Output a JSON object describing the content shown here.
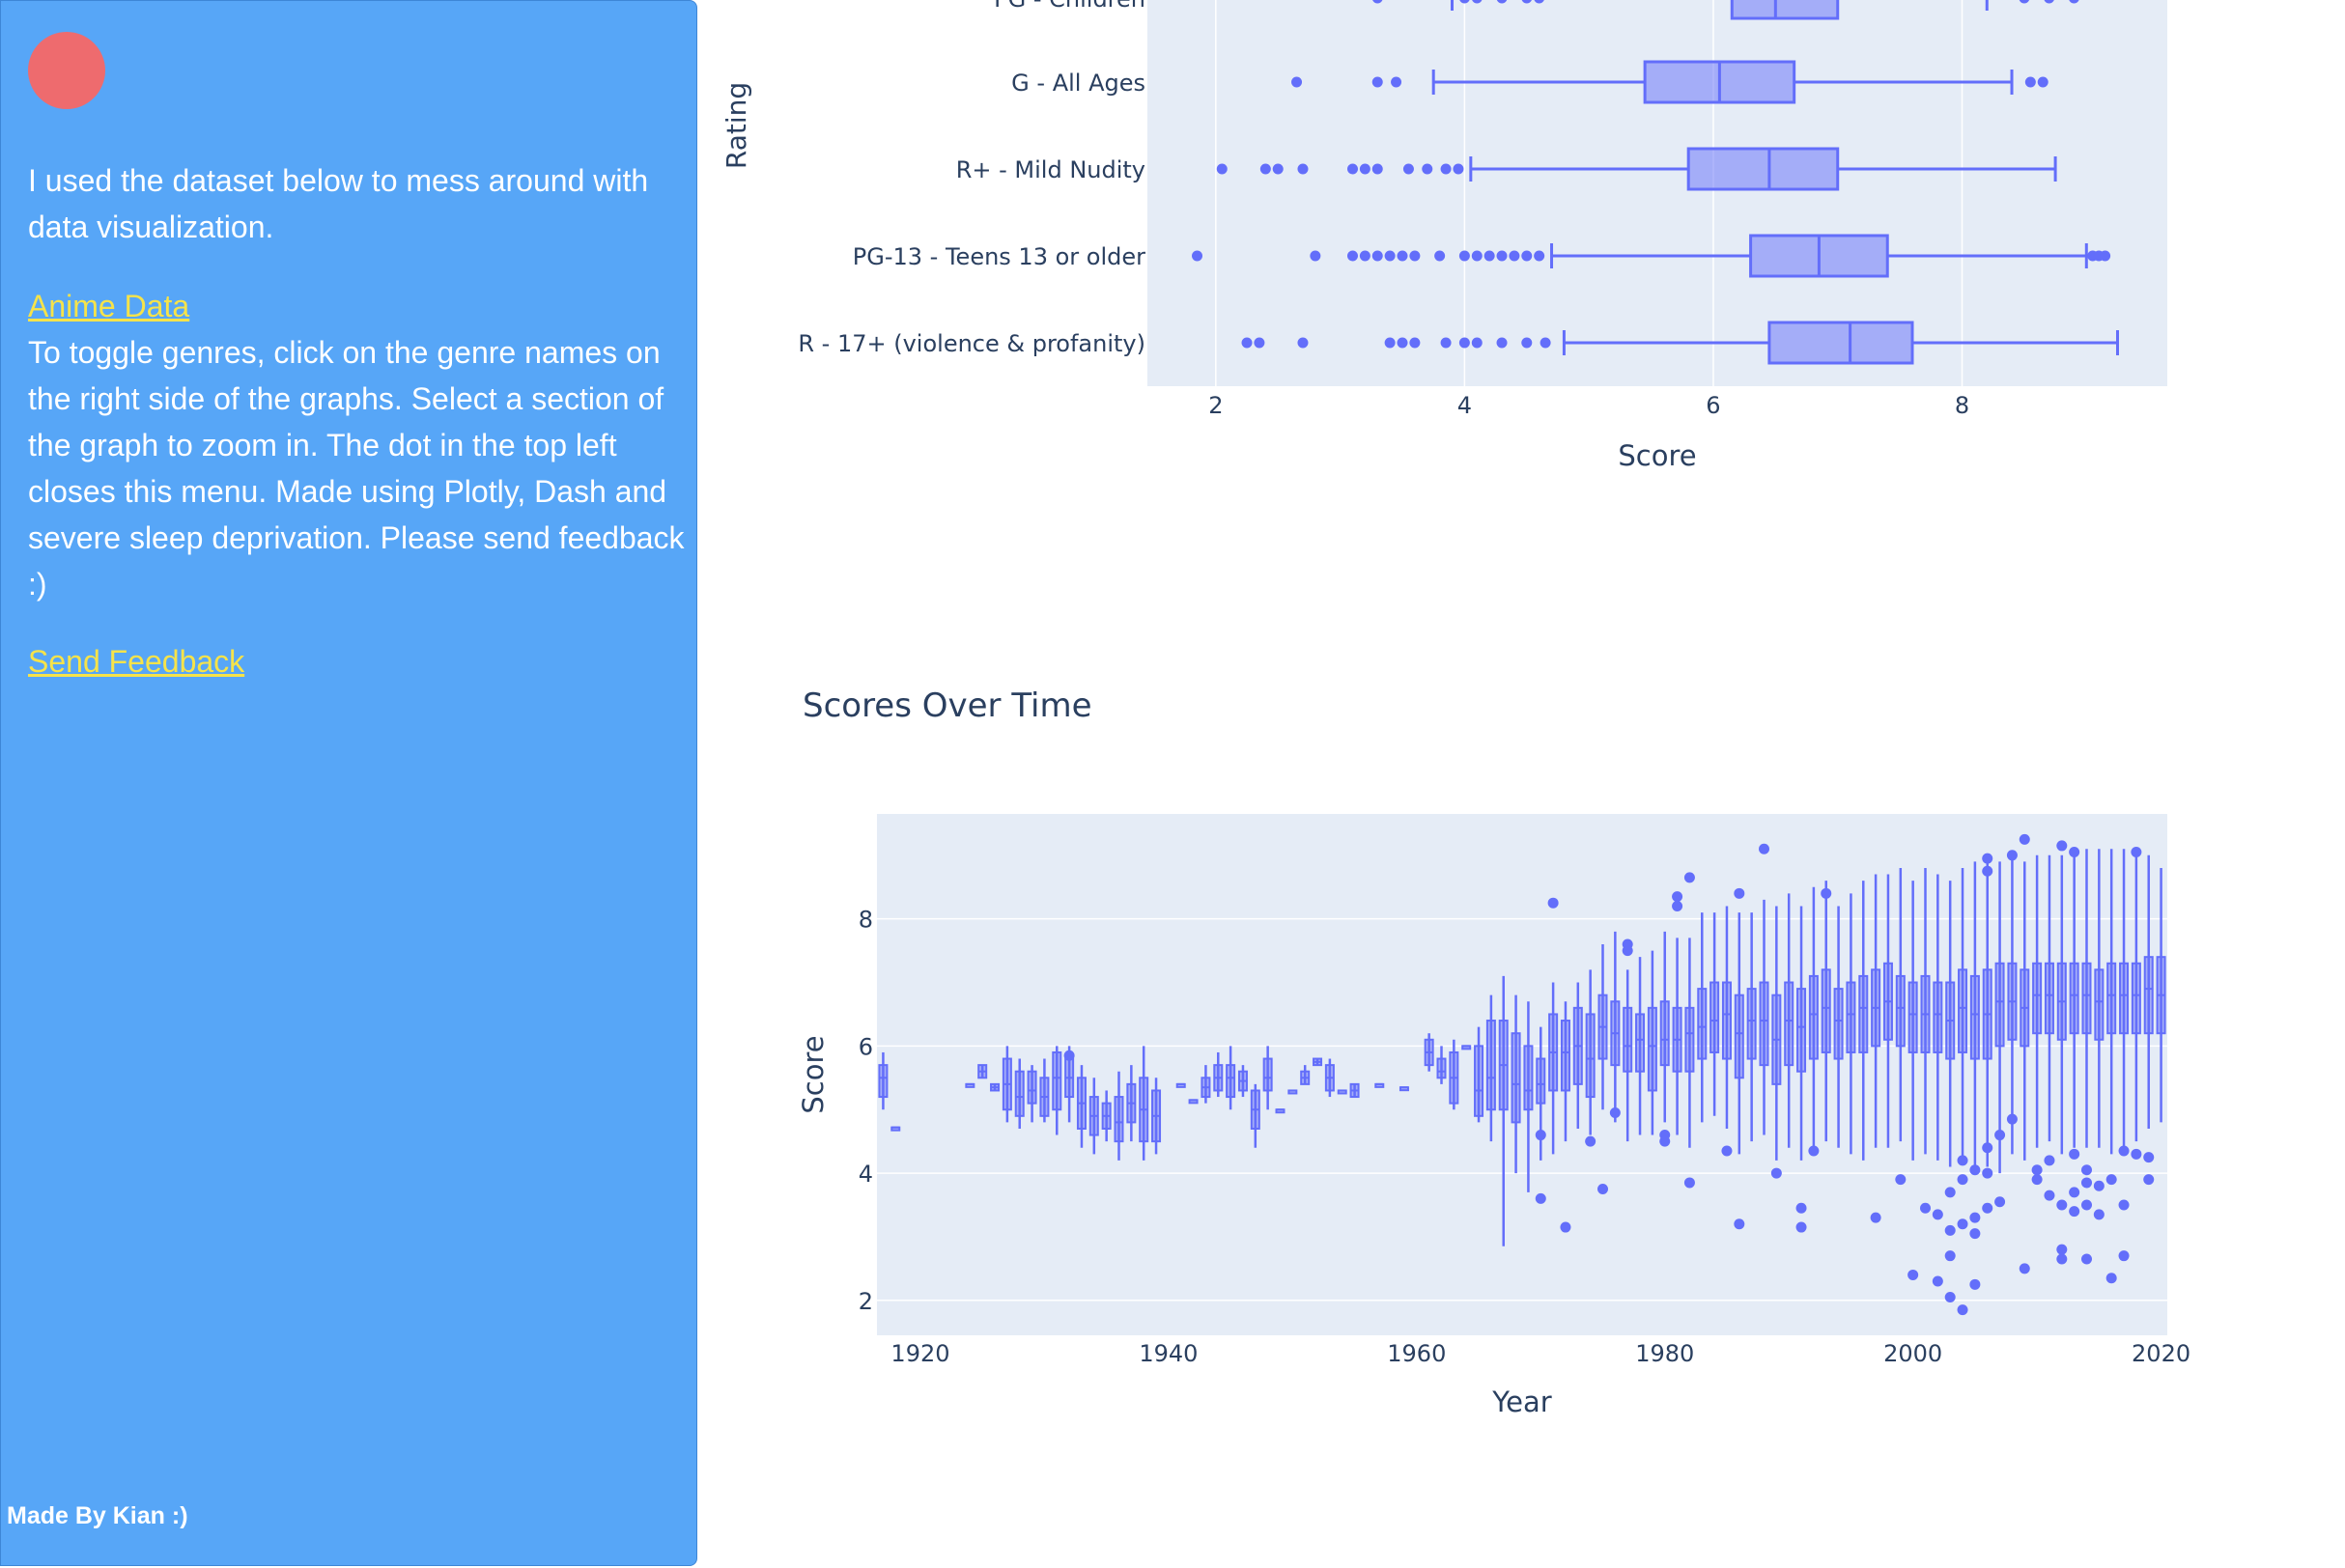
{
  "sidebar": {
    "intro": "I used the dataset below to mess around with data visualization.",
    "data_link": "Anime Data",
    "instructions": "To toggle genres, click on the genre names on the right side of the graphs. Select a section of the graph to zoom in. The dot in the top left closes this menu. Made using Plotly, Dash and severe sleep deprivation. Please send feedback :)",
    "feedback_link": "Send Feedback",
    "footer": "Made By Kian :)",
    "colors": {
      "background": "#57a6f7",
      "close_dot": "#ee6b6e",
      "link": "#f6e34a"
    }
  },
  "chart_data": [
    {
      "type": "box",
      "orientation": "horizontal",
      "ylabel": "Rating",
      "xlabel": "Score",
      "x_ticks": [
        2,
        4,
        6,
        8
      ],
      "xlim": [
        1.45,
        9.65
      ],
      "color": "#636efa",
      "categories": [
        {
          "name": "PG - Children",
          "min": 3.9,
          "q1": 6.15,
          "median": 6.5,
          "q3": 7.0,
          "max": 8.2,
          "outliers": [
            3.3,
            4.0,
            4.1,
            4.3,
            4.5,
            4.6,
            8.5,
            8.7,
            8.9
          ],
          "partial": true
        },
        {
          "name": "G - All Ages",
          "min": 3.75,
          "q1": 5.45,
          "median": 6.05,
          "q3": 6.65,
          "max": 8.4,
          "outliers": [
            2.65,
            3.3,
            3.45,
            8.55,
            8.65
          ]
        },
        {
          "name": "R+ - Mild Nudity",
          "min": 4.05,
          "q1": 5.8,
          "median": 6.45,
          "q3": 7.0,
          "max": 8.75,
          "outliers": [
            2.05,
            2.4,
            2.5,
            2.7,
            3.1,
            3.2,
            3.3,
            3.55,
            3.7,
            3.85,
            3.95
          ]
        },
        {
          "name": "PG-13 - Teens 13 or older",
          "min": 4.7,
          "q1": 6.3,
          "median": 6.85,
          "q3": 7.4,
          "max": 9.0,
          "outliers": [
            1.85,
            2.8,
            3.1,
            3.2,
            3.3,
            3.4,
            3.5,
            3.6,
            3.8,
            4.0,
            4.1,
            4.2,
            4.3,
            4.4,
            4.5,
            4.6,
            9.05,
            9.1,
            9.15
          ]
        },
        {
          "name": "R - 17+ (violence & profanity)",
          "min": 4.8,
          "q1": 6.45,
          "median": 7.1,
          "q3": 7.6,
          "max": 9.25,
          "outliers": [
            2.25,
            2.35,
            2.7,
            3.4,
            3.5,
            3.6,
            3.85,
            4.0,
            4.1,
            4.3,
            4.5,
            4.65
          ]
        }
      ]
    },
    {
      "type": "box",
      "orientation": "vertical",
      "title": "Scores Over Time",
      "xlabel": "Year",
      "ylabel": "Score",
      "x_ticks": [
        1920,
        1940,
        1960,
        1980,
        2000,
        2020
      ],
      "y_ticks": [
        2,
        4,
        6,
        8
      ],
      "xlim": [
        1916.5,
        2020.5
      ],
      "ylim": [
        1.45,
        9.65
      ],
      "color": "#636efa",
      "boxes": [
        [
          1917,
          5.2,
          5.7,
          5.0,
          5.9,
          5.5
        ],
        [
          1918,
          4.72,
          4.72,
          4.72,
          4.72,
          4.72
        ],
        [
          1924,
          5.4,
          5.4,
          5.4,
          5.4,
          5.4
        ],
        [
          1925,
          5.5,
          5.7,
          5.5,
          5.7,
          5.6
        ],
        [
          1926,
          5.3,
          5.4,
          5.3,
          5.4,
          5.35
        ],
        [
          1927,
          5.0,
          5.8,
          4.8,
          6.0,
          5.4
        ],
        [
          1928,
          4.9,
          5.6,
          4.7,
          5.8,
          5.2
        ],
        [
          1929,
          5.1,
          5.6,
          4.8,
          5.7,
          5.3
        ],
        [
          1930,
          4.9,
          5.5,
          4.8,
          5.8,
          5.2
        ],
        [
          1931,
          5.0,
          5.9,
          4.6,
          6.0,
          5.5
        ],
        [
          1932,
          5.2,
          5.8,
          4.8,
          6.0,
          5.5
        ],
        [
          1933,
          4.7,
          5.5,
          4.4,
          5.7,
          5.1
        ],
        [
          1934,
          4.6,
          5.2,
          4.3,
          5.5,
          4.9
        ],
        [
          1935,
          4.7,
          5.1,
          4.5,
          5.3,
          4.9
        ],
        [
          1936,
          4.5,
          5.2,
          4.2,
          5.6,
          4.8
        ],
        [
          1937,
          4.8,
          5.4,
          4.5,
          5.7,
          5.1
        ],
        [
          1938,
          4.5,
          5.5,
          4.2,
          6.0,
          5.0
        ],
        [
          1939,
          4.5,
          5.3,
          4.3,
          5.5,
          4.9
        ],
        [
          1941,
          5.4,
          5.4,
          5.4,
          5.4,
          5.4
        ],
        [
          1942,
          5.15,
          5.15,
          5.15,
          5.15,
          5.15
        ],
        [
          1943,
          5.2,
          5.5,
          5.1,
          5.7,
          5.35
        ],
        [
          1944,
          5.3,
          5.7,
          5.2,
          5.9,
          5.5
        ],
        [
          1945,
          5.2,
          5.7,
          5.0,
          6.0,
          5.5
        ],
        [
          1946,
          5.3,
          5.6,
          5.2,
          5.7,
          5.45
        ],
        [
          1947,
          4.7,
          5.3,
          4.4,
          5.4,
          5.0
        ],
        [
          1948,
          5.3,
          5.8,
          5.0,
          6.0,
          5.5
        ],
        [
          1949,
          5.0,
          5.0,
          5.0,
          5.0,
          5.0
        ],
        [
          1950,
          5.3,
          5.3,
          5.3,
          5.3,
          5.3
        ],
        [
          1951,
          5.4,
          5.6,
          5.4,
          5.7,
          5.5
        ],
        [
          1952,
          5.7,
          5.8,
          5.7,
          5.8,
          5.75
        ],
        [
          1953,
          5.3,
          5.7,
          5.2,
          5.8,
          5.5
        ],
        [
          1954,
          5.3,
          5.3,
          5.3,
          5.3,
          5.3
        ],
        [
          1955,
          5.2,
          5.4,
          5.2,
          5.4,
          5.3
        ],
        [
          1957,
          5.4,
          5.4,
          5.4,
          5.4,
          5.4
        ],
        [
          1959,
          5.35,
          5.35,
          5.35,
          5.35,
          5.35
        ],
        [
          1961,
          5.7,
          6.1,
          5.6,
          6.2,
          5.9
        ],
        [
          1962,
          5.5,
          5.8,
          5.4,
          6.0,
          5.6
        ],
        [
          1963,
          5.1,
          5.9,
          5.0,
          6.1,
          5.5
        ],
        [
          1964,
          6.0,
          6.0,
          6.0,
          6.0,
          6.0
        ],
        [
          1965,
          4.9,
          6.0,
          4.8,
          6.3,
          5.3
        ],
        [
          1966,
          5.0,
          6.4,
          4.5,
          6.8,
          5.5
        ],
        [
          1967,
          5.0,
          6.4,
          2.85,
          7.1,
          5.7
        ],
        [
          1968,
          4.8,
          6.2,
          4.0,
          6.8,
          5.4
        ],
        [
          1969,
          5.0,
          6.0,
          3.7,
          6.7,
          5.3
        ],
        [
          1970,
          5.1,
          5.8,
          4.2,
          6.3,
          5.4
        ],
        [
          1971,
          5.3,
          6.5,
          4.3,
          7.0,
          5.9
        ],
        [
          1972,
          5.3,
          6.4,
          4.5,
          6.7,
          5.9
        ],
        [
          1973,
          5.4,
          6.6,
          4.7,
          7.0,
          6.0
        ],
        [
          1974,
          5.2,
          6.5,
          4.6,
          7.2,
          5.8
        ],
        [
          1975,
          5.8,
          6.8,
          5.0,
          7.6,
          6.3
        ],
        [
          1976,
          5.7,
          6.7,
          4.8,
          7.8,
          6.2
        ],
        [
          1977,
          5.6,
          6.6,
          4.5,
          7.2,
          6.0
        ],
        [
          1978,
          5.6,
          6.5,
          4.6,
          7.4,
          6.1
        ],
        [
          1979,
          5.3,
          6.6,
          4.6,
          7.5,
          6.0
        ],
        [
          1980,
          5.7,
          6.7,
          4.8,
          7.8,
          6.1
        ],
        [
          1981,
          5.6,
          6.6,
          4.6,
          7.7,
          6.1
        ],
        [
          1982,
          5.6,
          6.6,
          4.4,
          7.7,
          6.2
        ],
        [
          1983,
          5.8,
          6.9,
          4.8,
          8.1,
          6.3
        ],
        [
          1984,
          5.9,
          7.0,
          4.9,
          8.1,
          6.4
        ],
        [
          1985,
          5.8,
          7.0,
          4.7,
          8.2,
          6.5
        ],
        [
          1986,
          5.5,
          6.8,
          4.3,
          8.1,
          6.2
        ],
        [
          1987,
          5.8,
          6.9,
          4.5,
          8.1,
          6.4
        ],
        [
          1988,
          5.7,
          7.0,
          4.6,
          8.3,
          6.4
        ],
        [
          1989,
          5.4,
          6.8,
          4.2,
          8.2,
          6.1
        ],
        [
          1990,
          5.7,
          7.0,
          4.4,
          8.4,
          6.4
        ],
        [
          1991,
          5.6,
          6.9,
          4.2,
          8.2,
          6.3
        ],
        [
          1992,
          5.8,
          7.1,
          4.3,
          8.5,
          6.5
        ],
        [
          1993,
          5.9,
          7.2,
          4.5,
          8.6,
          6.6
        ],
        [
          1994,
          5.8,
          6.9,
          4.4,
          8.2,
          6.4
        ],
        [
          1995,
          5.9,
          7.0,
          4.3,
          8.4,
          6.5
        ],
        [
          1996,
          5.9,
          7.1,
          4.2,
          8.6,
          6.6
        ],
        [
          1997,
          6.0,
          7.2,
          4.4,
          8.7,
          6.6
        ],
        [
          1998,
          6.1,
          7.3,
          4.4,
          8.7,
          6.7
        ],
        [
          1999,
          6.0,
          7.1,
          4.5,
          8.8,
          6.6
        ],
        [
          2000,
          5.9,
          7.0,
          4.2,
          8.6,
          6.5
        ],
        [
          2001,
          5.9,
          7.1,
          4.3,
          8.8,
          6.5
        ],
        [
          2002,
          5.9,
          7.0,
          4.2,
          8.7,
          6.5
        ],
        [
          2003,
          5.8,
          7.0,
          4.1,
          8.6,
          6.4
        ],
        [
          2004,
          5.9,
          7.2,
          4.2,
          8.8,
          6.6
        ],
        [
          2005,
          5.8,
          7.1,
          4.0,
          8.9,
          6.5
        ],
        [
          2006,
          5.8,
          7.2,
          4.1,
          8.9,
          6.5
        ],
        [
          2007,
          6.0,
          7.3,
          4.0,
          8.9,
          6.7
        ],
        [
          2008,
          6.1,
          7.3,
          4.3,
          9.0,
          6.7
        ],
        [
          2009,
          6.0,
          7.2,
          4.2,
          8.9,
          6.6
        ],
        [
          2010,
          6.2,
          7.3,
          4.4,
          9.0,
          6.8
        ],
        [
          2011,
          6.2,
          7.3,
          4.5,
          9.0,
          6.8
        ],
        [
          2012,
          6.1,
          7.3,
          4.3,
          9.0,
          6.7
        ],
        [
          2013,
          6.2,
          7.3,
          4.4,
          9.1,
          6.8
        ],
        [
          2014,
          6.2,
          7.3,
          4.4,
          9.1,
          6.8
        ],
        [
          2015,
          6.1,
          7.2,
          4.4,
          9.1,
          6.7
        ],
        [
          2016,
          6.2,
          7.3,
          4.3,
          9.1,
          6.8
        ],
        [
          2017,
          6.2,
          7.3,
          4.4,
          9.1,
          6.8
        ],
        [
          2018,
          6.2,
          7.3,
          4.5,
          9.1,
          6.8
        ],
        [
          2019,
          6.2,
          7.4,
          4.7,
          9.0,
          6.9
        ],
        [
          2020,
          6.2,
          7.4,
          4.8,
          8.8,
          6.8
        ]
      ],
      "outliers": [
        [
          1932,
          5.85
        ],
        [
          1970,
          4.6
        ],
        [
          1970,
          3.6
        ],
        [
          1971,
          8.25
        ],
        [
          1972,
          3.15
        ],
        [
          1974,
          4.5
        ],
        [
          1975,
          3.75
        ],
        [
          1976,
          4.95
        ],
        [
          1977,
          7.6
        ],
        [
          1977,
          7.5
        ],
        [
          1980,
          4.6
        ],
        [
          1980,
          4.5
        ],
        [
          1981,
          8.2
        ],
        [
          1981,
          8.35
        ],
        [
          1982,
          8.65
        ],
        [
          1982,
          3.85
        ],
        [
          1985,
          4.35
        ],
        [
          1986,
          8.4
        ],
        [
          1986,
          3.2
        ],
        [
          1988,
          9.1
        ],
        [
          1989,
          4.0
        ],
        [
          1991,
          3.45
        ],
        [
          1991,
          3.15
        ],
        [
          1992,
          4.35
        ],
        [
          1993,
          8.4
        ],
        [
          1997,
          3.3
        ],
        [
          1999,
          3.9
        ],
        [
          2000,
          2.4
        ],
        [
          2001,
          3.45
        ],
        [
          2002,
          2.3
        ],
        [
          2002,
          3.35
        ],
        [
          2003,
          2.05
        ],
        [
          2003,
          2.7
        ],
        [
          2003,
          3.1
        ],
        [
          2003,
          3.7
        ],
        [
          2004,
          1.85
        ],
        [
          2004,
          4.2
        ],
        [
          2004,
          3.9
        ],
        [
          2004,
          3.2
        ],
        [
          2005,
          2.25
        ],
        [
          2005,
          3.05
        ],
        [
          2005,
          3.3
        ],
        [
          2005,
          4.05
        ],
        [
          2006,
          4.0
        ],
        [
          2006,
          4.4
        ],
        [
          2006,
          3.45
        ],
        [
          2006,
          8.95
        ],
        [
          2006,
          8.75
        ],
        [
          2007,
          3.55
        ],
        [
          2007,
          4.6
        ],
        [
          2008,
          9.0
        ],
        [
          2008,
          4.85
        ],
        [
          2009,
          2.5
        ],
        [
          2009,
          9.25
        ],
        [
          2010,
          4.05
        ],
        [
          2010,
          3.9
        ],
        [
          2011,
          3.65
        ],
        [
          2011,
          4.2
        ],
        [
          2012,
          9.15
        ],
        [
          2012,
          3.5
        ],
        [
          2012,
          2.8
        ],
        [
          2012,
          2.65
        ],
        [
          2013,
          9.05
        ],
        [
          2013,
          4.3
        ],
        [
          2013,
          3.7
        ],
        [
          2013,
          3.4
        ],
        [
          2014,
          4.05
        ],
        [
          2014,
          3.85
        ],
        [
          2014,
          3.5
        ],
        [
          2014,
          2.65
        ],
        [
          2015,
          3.8
        ],
        [
          2015,
          3.35
        ],
        [
          2016,
          2.35
        ],
        [
          2016,
          3.9
        ],
        [
          2017,
          4.35
        ],
        [
          2017,
          3.5
        ],
        [
          2017,
          2.7
        ],
        [
          2018,
          9.05
        ],
        [
          2018,
          4.3
        ],
        [
          2019,
          4.25
        ],
        [
          2019,
          3.9
        ]
      ]
    }
  ]
}
